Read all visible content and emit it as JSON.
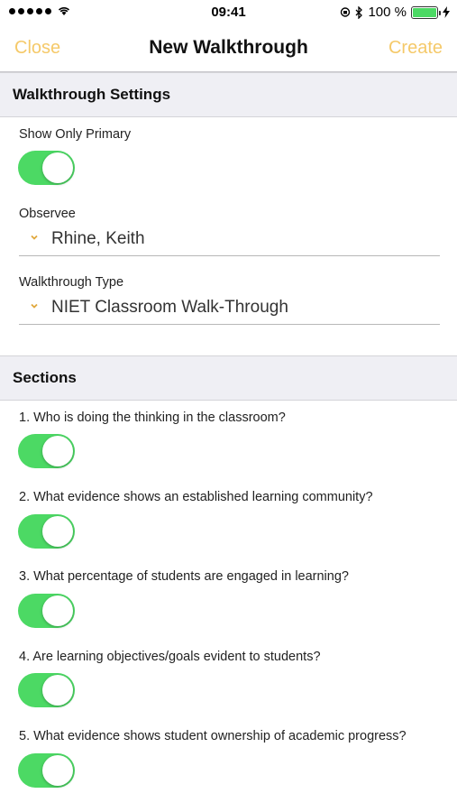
{
  "status_bar": {
    "time": "09:41",
    "battery_percent": "100 %",
    "battery_level": 1.0,
    "signal_dots": 5
  },
  "nav": {
    "left_label": "Close",
    "title": "New Walkthrough",
    "right_label": "Create",
    "accent_color": "#f5c969"
  },
  "walkthrough_settings": {
    "header": "Walkthrough Settings",
    "show_only_primary": {
      "label": "Show Only Primary",
      "on": true
    },
    "observee": {
      "label": "Observee",
      "value": "Rhine, Keith"
    },
    "walkthrough_type": {
      "label": "Walkthrough Type",
      "value": "NIET Classroom Walk-Through"
    }
  },
  "sections": {
    "header": "Sections",
    "items": [
      {
        "label": "1. Who is doing the thinking in the classroom?",
        "on": true
      },
      {
        "label": "2. What evidence shows an established learning community?",
        "on": true
      },
      {
        "label": "3. What percentage of students are engaged in learning?",
        "on": true
      },
      {
        "label": "4. Are learning objectives/goals evident to students?",
        "on": true
      },
      {
        "label": "5. What evidence shows student ownership of academic progress?",
        "on": true
      }
    ]
  },
  "colors": {
    "toggle_on": "#4cd964",
    "section_bg": "#efeff4"
  }
}
